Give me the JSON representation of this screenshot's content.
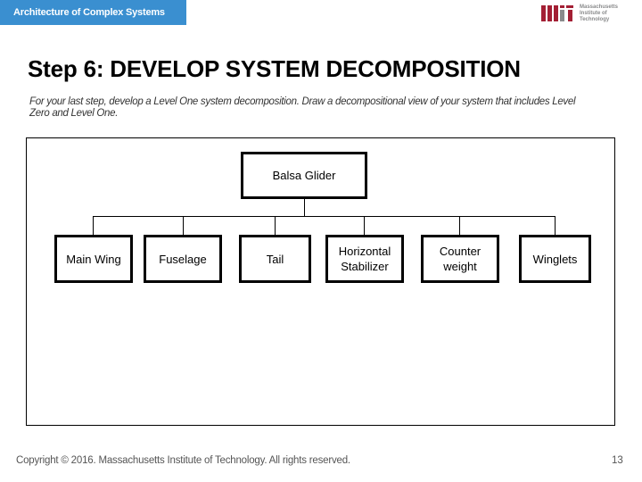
{
  "header": {
    "course_title": "Architecture of Complex Systems",
    "logo": {
      "name": "mit-logo-icon",
      "text_lines": [
        "Massachusetts",
        "Institute of",
        "Technology"
      ],
      "colors": {
        "primary": "#a31f34",
        "secondary": "#8a8b8c"
      }
    },
    "tab_color": "#3a8fd0"
  },
  "slide": {
    "title": "Step 6: DEVELOP SYSTEM DECOMPOSITION",
    "instructions": "For your last step, develop a Level One system decomposition. Draw a decompositional view of your system that includes Level Zero and Level One."
  },
  "diagram": {
    "level_zero": "Balsa Glider",
    "level_one": [
      [
        "Main Wing"
      ],
      [
        "Fuselage"
      ],
      [
        "Tail"
      ],
      [
        "Horizontal",
        "Stabilizer"
      ],
      [
        "Counter",
        "weight"
      ],
      [
        "Winglets"
      ]
    ]
  },
  "footer": {
    "copyright": "Copyright © 2016. Massachusetts Institute of Technology. All rights reserved.",
    "page_number": "13"
  }
}
